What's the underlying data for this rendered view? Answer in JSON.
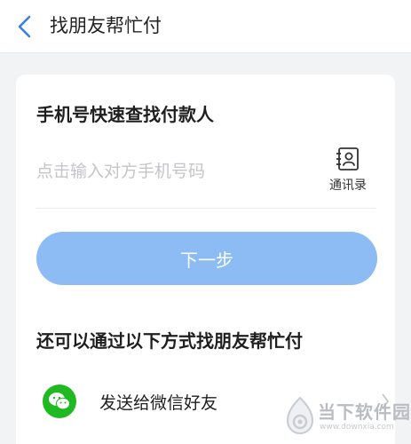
{
  "header": {
    "title": "找朋友帮忙付",
    "back_icon": "chevron-left-icon"
  },
  "phone_search": {
    "title": "手机号快速查找付款人",
    "placeholder": "点击输入对方手机号码",
    "value": "",
    "contacts_label": "通讯录",
    "contacts_icon": "contacts-book-icon"
  },
  "next_button": {
    "label": "下一步",
    "color": "#8dbcf5"
  },
  "alternatives": {
    "title": "还可以通过以下方式找朋友帮忙付",
    "items": [
      {
        "label": "发送给微信好友",
        "icon": "wechat-icon",
        "color": "#1fb922"
      }
    ]
  },
  "watermark": {
    "text": "当下软件园",
    "url": "www.downxia.com"
  }
}
